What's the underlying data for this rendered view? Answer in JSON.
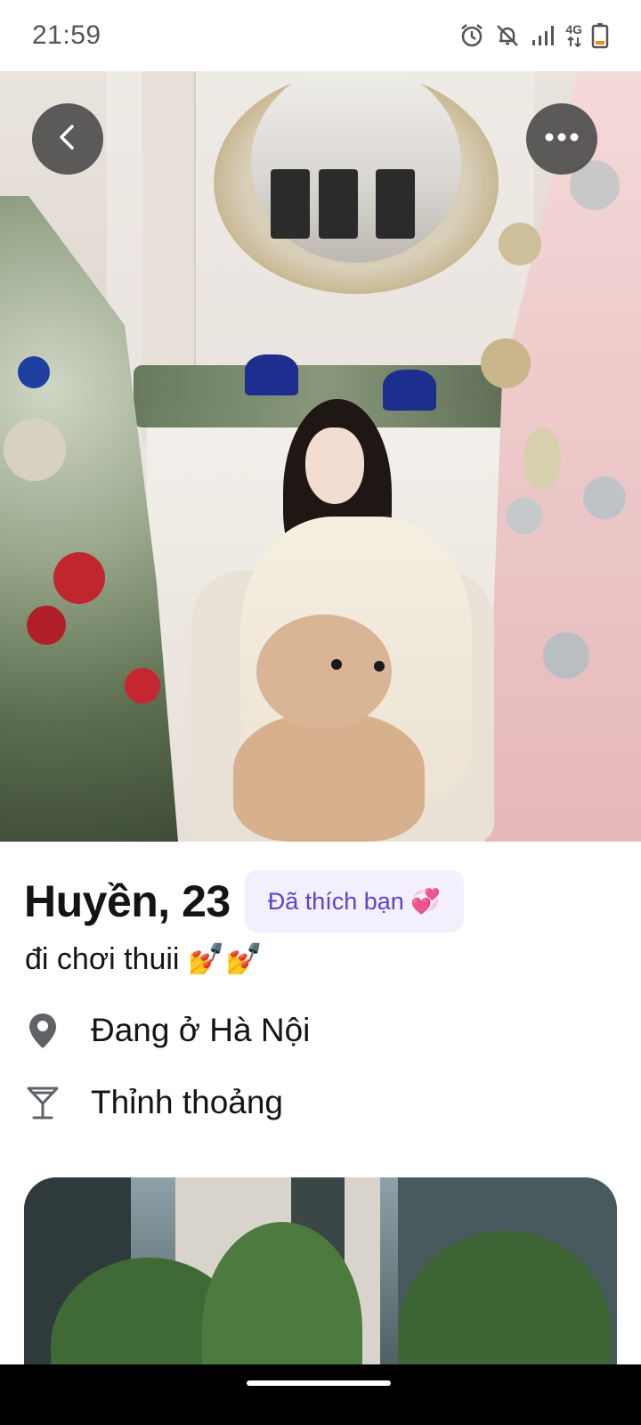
{
  "status_bar": {
    "time": "21:59",
    "network": "4G",
    "icons": [
      "alarm-icon",
      "notifications-off-icon",
      "signal-icon",
      "network-4g-icon",
      "battery-icon"
    ]
  },
  "photo_controls": {
    "back": "chevron-left-icon",
    "more": "more-horizontal-icon"
  },
  "profile": {
    "name_age": "Huyền, 23",
    "liked_badge": "Đã thích bạn 💞",
    "bio": "đi chơi thuii 💅💅",
    "location": "Đang ở Hà Nội",
    "drinking": "Thỉnh thoảng"
  },
  "colors": {
    "badge_bg": "#f3effd",
    "badge_text": "#5b45c9",
    "overlay_button": "#3c3c3c"
  }
}
